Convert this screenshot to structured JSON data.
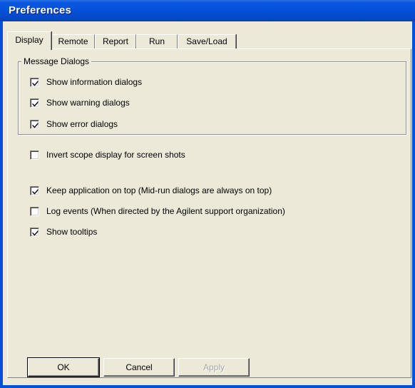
{
  "window": {
    "title": "Preferences"
  },
  "tabs": [
    {
      "label": "Display",
      "active": true
    },
    {
      "label": "Remote",
      "active": false
    },
    {
      "label": "Report",
      "active": false
    },
    {
      "label": "Run",
      "active": false
    },
    {
      "label": "Save/Load",
      "active": false
    }
  ],
  "message_dialogs": {
    "legend": "Message Dialogs",
    "options": [
      {
        "label": "Show information dialogs",
        "checked": true
      },
      {
        "label": "Show warning dialogs",
        "checked": true
      },
      {
        "label": "Show error dialogs",
        "checked": true
      }
    ]
  },
  "options": {
    "invert_scope": {
      "label": "Invert scope display for screen shots",
      "checked": false
    },
    "keep_on_top": {
      "label": "Keep application on top (Mid-run dialogs are always on top)",
      "checked": true
    },
    "log_events": {
      "label": "Log events (When directed by the Agilent support organization)",
      "checked": false
    },
    "show_tooltips": {
      "label": "Show tooltips",
      "checked": true
    }
  },
  "buttons": {
    "ok": "OK",
    "cancel": "Cancel",
    "apply": "Apply"
  },
  "colors": {
    "titlebar": "#0550d8",
    "face": "#ece9d8",
    "disabled_text": "#a7a6a1"
  }
}
